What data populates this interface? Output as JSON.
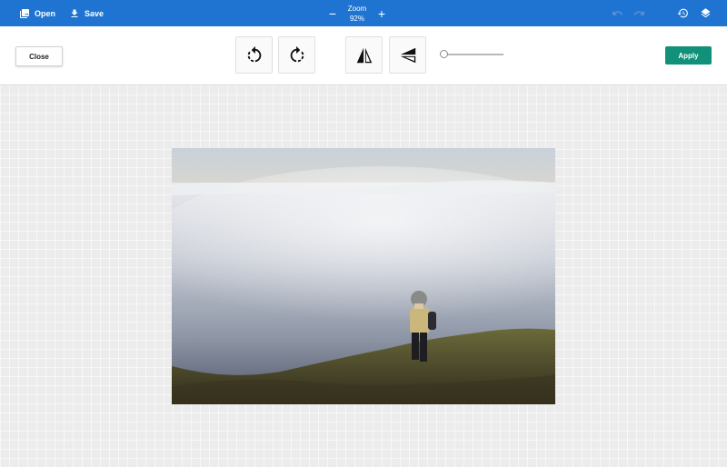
{
  "topbar": {
    "open_label": "Open",
    "save_label": "Save",
    "zoom_label": "Zoom",
    "zoom_value": "92%",
    "zoom_out": "−",
    "zoom_in": "+",
    "icons": [
      "image-icon",
      "download-icon",
      "undo-icon",
      "redo-icon",
      "history-icon",
      "layers-icon"
    ],
    "bg_color": "#1f74d2"
  },
  "toolbar": {
    "close_label": "Close",
    "apply_label": "Apply",
    "apply_color": "#11907a",
    "tools": [
      "rotate-left-icon",
      "rotate-right-icon",
      "flip-horizontal-icon",
      "flip-vertical-icon"
    ],
    "slider_value": 0
  }
}
